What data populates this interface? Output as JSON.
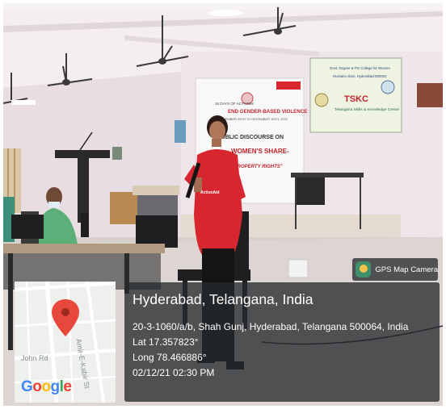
{
  "gps_tag": {
    "app_name": "GPS Map Camera",
    "icon": "gps-map-camera-icon"
  },
  "location_card": {
    "title": "Hyderabad, Telangana, India",
    "address": "20-3-1060/a/b, Shah Gunj, Hyderabad, Telangana 500064, India",
    "latitude": "Lat 17.357823°",
    "longitude": "Long 78.466886°",
    "datetime": "02/12/21 02:30 PM"
  },
  "map": {
    "street_1": "John Rd",
    "street_2": "Amir-E-Kabir St",
    "provider": {
      "g1": "G",
      "o1": "o",
      "o2": "o",
      "g2": "g",
      "l": "l",
      "e": "e"
    },
    "marker_icon": "map-pin-icon"
  },
  "banner_main": {
    "header": "16 DAYS OF ACTIVISM",
    "line1": "END GENDER-BASED VIOLENCE",
    "line2": "NOVEMBER 25TH TO DECEMBER 10TH, 2021",
    "line3": "PUBLIC DISCOURSE ON",
    "line4": "WOMEN'S SHARE-",
    "line5": "IN PROPERTY RIGHTS\""
  },
  "banner_right": {
    "line1": "Govt. Degree & PG College for Women",
    "line2": "Hussaini Alam, Hyderabad-500002",
    "logo_text": "TSKC",
    "line3": "Telangana Skills & Knowledge Centre"
  },
  "speaker_shirt": {
    "text": "ActionAid"
  },
  "colors": {
    "overlay": "#262a2e",
    "pin": "#e8473b",
    "google_blue": "#4285F4",
    "google_red": "#EA4335",
    "google_yellow": "#FBBC05",
    "google_green": "#34A853",
    "shirt": "#d8262e"
  }
}
